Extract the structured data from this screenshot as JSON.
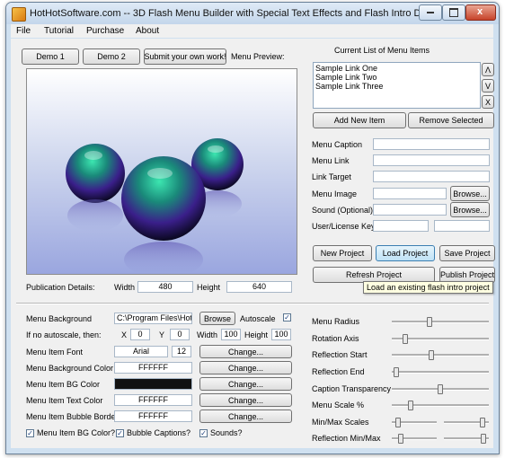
{
  "window": {
    "title": "HotHotSoftware.com -- 3D Flash Menu Builder with Special Text Effects and Flash Intro Designer",
    "minimize": "–",
    "maximize": "□",
    "close": "x"
  },
  "menubar": [
    "File",
    "Tutorial",
    "Purchase",
    "About"
  ],
  "top_buttons": {
    "demo1": "Demo 1",
    "demo2": "Demo 2",
    "submit": "Submit your own work!",
    "menu_preview_label": "Menu Preview:"
  },
  "menu_items": {
    "header": "Current List of Menu Items",
    "items": [
      "Sample Link One",
      "Sample Link Two",
      "Sample Link Three"
    ],
    "up": "Λ",
    "down": "V",
    "remove": "X",
    "add_new": "Add New Item",
    "remove_selected": "Remove Selected"
  },
  "item_fields": {
    "caption": "Menu Caption",
    "link": "Menu Link",
    "target": "Link Target",
    "image": "Menu Image",
    "sound": "Sound (Optional)",
    "license": "User/License Key",
    "browse": "Browse..."
  },
  "project_buttons": {
    "new": "New Project",
    "load": "Load Project",
    "save": "Save Project",
    "refresh": "Refresh Project",
    "publish": "Publish Project",
    "tooltip": "Load an existing flash intro project"
  },
  "publication": {
    "label": "Publication Details:",
    "width_label": "Width",
    "width": "480",
    "height_label": "Height",
    "height": "640"
  },
  "background": {
    "label": "Menu Background",
    "path": "C:\\Program Files\\HotH",
    "browse": "Browse",
    "autoscale_label": "Autoscale",
    "autoscale": true,
    "noscale_label": "If no autoscale, then:",
    "x_label": "X",
    "x": "0",
    "y_label": "Y",
    "y": "0",
    "width_label": "Width",
    "width": "100",
    "height_label": "Height",
    "height": "100"
  },
  "style_rows": {
    "font_label": "Menu Item Font",
    "font": "Arial",
    "font_size": "12",
    "bg_color_label": "Menu Background Color",
    "bg_color": "FFFFFF",
    "item_bg_label": "Menu Item BG Color",
    "item_bg_color": "#111111",
    "text_color_label": "Menu Item Text Color",
    "text_color": "FFFFFF",
    "bubble_border_label": "Menu Item Bubble Border",
    "bubble_border": "FFFFFF",
    "change": "Change..."
  },
  "checkboxes": [
    {
      "label": "Menu Item BG Color?",
      "checked": true
    },
    {
      "label": "Bubble Captions?",
      "checked": true
    },
    {
      "label": "Sounds?",
      "checked": true
    }
  ],
  "sliders": [
    {
      "label": "Menu Radius",
      "value": 0.38
    },
    {
      "label": "Rotation Axis",
      "value": 0.12
    },
    {
      "label": "Reflection Start",
      "value": 0.4
    },
    {
      "label": "Reflection End",
      "value": 0.02
    },
    {
      "label": "Caption Transparency",
      "value": 0.5
    },
    {
      "label": "Menu Scale %",
      "value": 0.18
    },
    {
      "label": "Min/Max Scales",
      "value": 0.09,
      "value2": 0.9
    },
    {
      "label": "Reflection Min/Max",
      "value": 0.17,
      "value2": 0.93
    }
  ],
  "colors": {
    "window_frame": "#cfe0f0",
    "client": "#f0f0f0",
    "tooltip": "#ffffe1",
    "sphere_highlight": "#2bd6a0",
    "sphere_body": "#4b1f9e"
  }
}
